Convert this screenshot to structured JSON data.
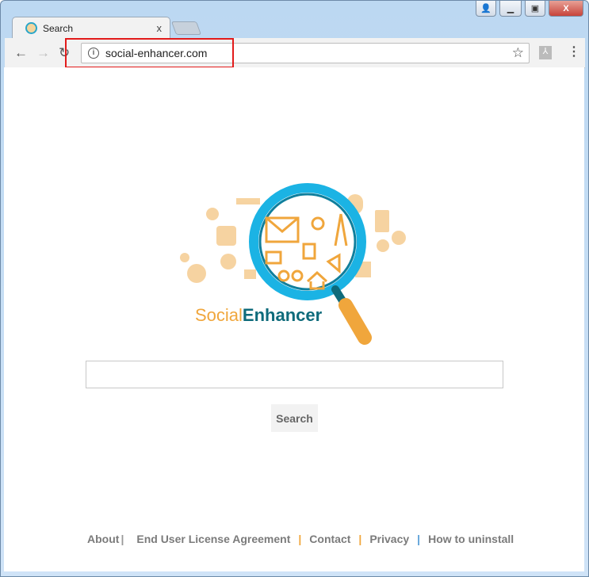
{
  "browser": {
    "tab_title": "Search",
    "url": "social-enhancer.com",
    "close_tab": "x"
  },
  "logo": {
    "text_a": "Social",
    "text_b": "Enhancer"
  },
  "search": {
    "placeholder": "",
    "button": "Search"
  },
  "footer": {
    "links": [
      "About",
      "End User License Agreement",
      "Contact",
      "Privacy",
      "How to uninstall"
    ],
    "sep": "|"
  },
  "colors": {
    "orange": "#f0a63c",
    "teal": "#0e6b7b",
    "cyan": "#1bb3e4",
    "highlight": "#e21b1b"
  }
}
